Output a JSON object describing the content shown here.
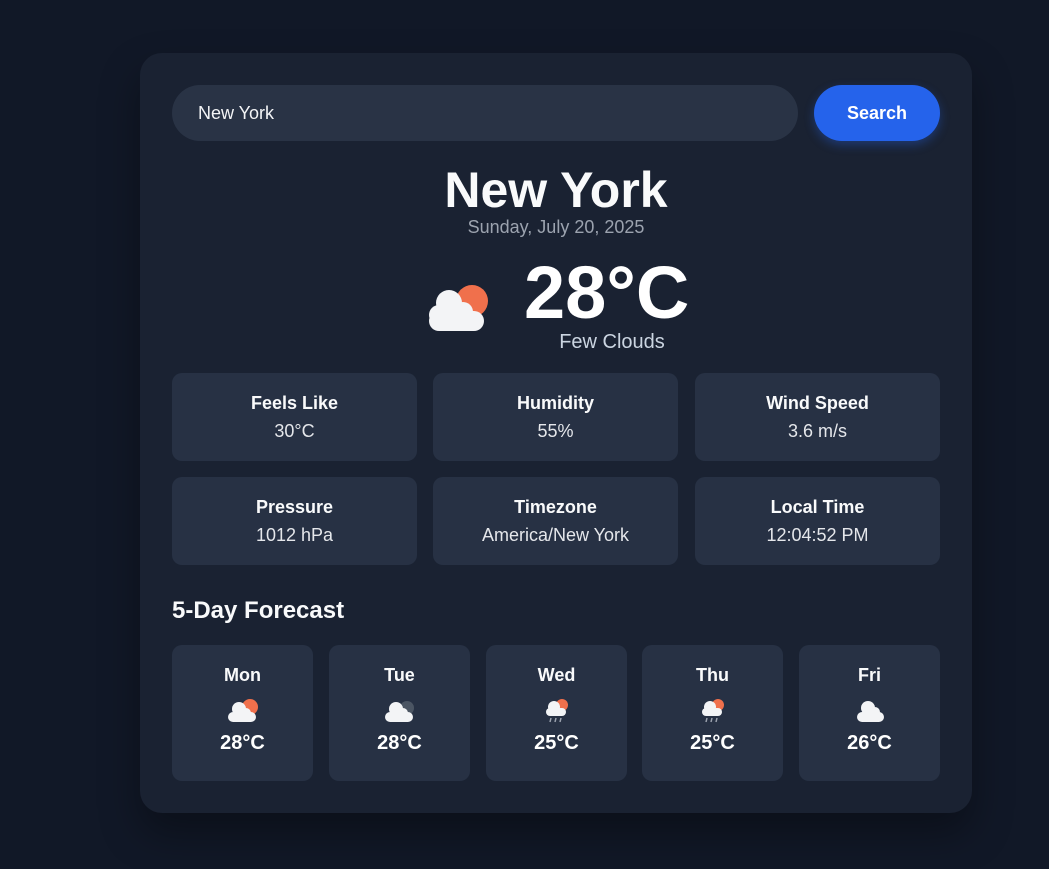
{
  "search": {
    "value": "New York",
    "button_label": "Search"
  },
  "location": {
    "city": "New York",
    "date": "Sunday, July 20, 2025"
  },
  "current": {
    "temperature": "28°C",
    "description": "Few Clouds",
    "icon": "few-clouds-icon"
  },
  "stats": [
    {
      "label": "Feels Like",
      "value": "30°C"
    },
    {
      "label": "Humidity",
      "value": "55%"
    },
    {
      "label": "Wind Speed",
      "value": "3.6 m/s"
    },
    {
      "label": "Pressure",
      "value": "1012 hPa"
    },
    {
      "label": "Timezone",
      "value": "America/New York"
    },
    {
      "label": "Local Time",
      "value": "12:04:52 PM"
    }
  ],
  "forecast": {
    "title": "5-Day Forecast",
    "days": [
      {
        "day": "Mon",
        "temp": "28°C",
        "icon": "few-clouds-icon"
      },
      {
        "day": "Tue",
        "temp": "28°C",
        "icon": "cloudy-night-icon"
      },
      {
        "day": "Wed",
        "temp": "25°C",
        "icon": "rain-sun-icon"
      },
      {
        "day": "Thu",
        "temp": "25°C",
        "icon": "rain-sun-icon"
      },
      {
        "day": "Fri",
        "temp": "26°C",
        "icon": "cloud-icon"
      }
    ]
  },
  "colors": {
    "background": "#111827",
    "card": "#1a2232",
    "tile": "#273144",
    "input": "#293345",
    "accent": "#2563eb",
    "sun": "#f0704c",
    "cloud": "#f3f4f6"
  }
}
